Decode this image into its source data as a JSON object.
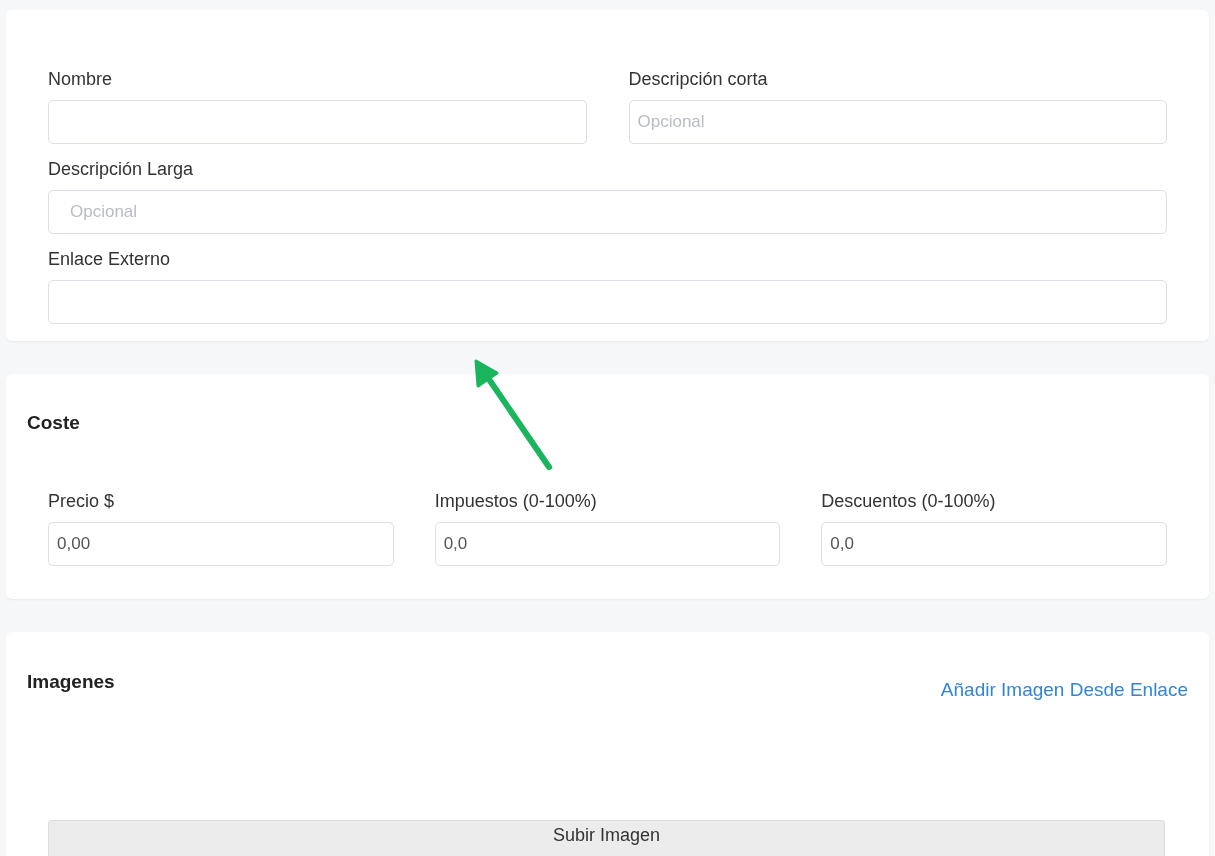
{
  "details": {
    "row": [
      {
        "label": "Nombre"
      },
      {
        "label": "Descripción corta",
        "placeholder": "Opcional"
      }
    ],
    "fields": [
      {
        "label": "Descripción Larga",
        "placeholder": "Opcional"
      },
      {
        "label": "Enlace Externo"
      }
    ]
  },
  "cost": {
    "title": "Coste",
    "fields": [
      {
        "label": "Precio $",
        "value": "0,00"
      },
      {
        "label": "Impuestos (0-100%)",
        "value": "0,0"
      },
      {
        "label": "Descuentos (0-100%)",
        "value": "0,0"
      }
    ]
  },
  "images": {
    "title": "Imagenes",
    "link": "Añadir Imagen Desde Enlace",
    "upload_button": "Subir Imagen"
  }
}
